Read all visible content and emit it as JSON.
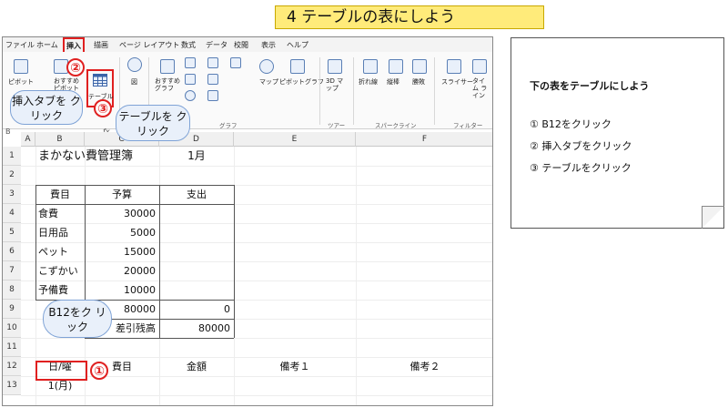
{
  "banner": "4 テーブルの表にしよう",
  "menu_tabs": [
    "ファイル",
    "ホーム",
    "挿入",
    "描画",
    "ページ レイアウト",
    "数式",
    "データ",
    "校閲",
    "表示",
    "ヘルプ"
  ],
  "ribbon": {
    "pivot_table": "ピボット",
    "recommended_pivot": "おすすめ ピボットテーブル",
    "table": "テーブル",
    "illustrations": "図",
    "recommended_charts": "おすすめ グラフ",
    "map": "マップ",
    "pivot_chart": "ピボットグラフ",
    "map3d": "3D マップ",
    "line": "折れ線",
    "column": "縦棒",
    "winloss": "勝敗",
    "slicer": "スライサー",
    "timeline": "タイム ライン",
    "group_chart": "グラフ",
    "group_tour": "ツアー",
    "group_sparkline": "スパークライン",
    "group_filter": "フィルター"
  },
  "formula_bar": {
    "namebox": "B",
    "fx": "fx"
  },
  "columns": [
    "A",
    "B",
    "C",
    "D",
    "E",
    "F"
  ],
  "rows": [
    "1",
    "2",
    "3",
    "4",
    "5",
    "6",
    "7",
    "8",
    "9",
    "10",
    "11",
    "12",
    "13"
  ],
  "sheet": {
    "title": "まかない費管理簿",
    "month": "1月",
    "headers": [
      "費目",
      "予算",
      "支出"
    ],
    "items": [
      {
        "name": "食費",
        "budget": "30000"
      },
      {
        "name": "日用品",
        "budget": "5000"
      },
      {
        "name": "ペット",
        "budget": "15000"
      },
      {
        "name": "こずかい",
        "budget": "20000"
      },
      {
        "name": "予備費",
        "budget": "10000"
      }
    ],
    "total_budget": "80000",
    "total_spend": "0",
    "balance_label": "差引残高",
    "balance": "80000",
    "row12": [
      "日/曜",
      "費目",
      "金額",
      "備考１",
      "備考２"
    ],
    "row13_date": "1(月)"
  },
  "callouts": {
    "tab": "挿入タブを クリック",
    "table": "テーブルを クリック",
    "cell": "B12をク リック"
  },
  "badges": [
    "①",
    "②",
    "③"
  ],
  "note": {
    "title": "下の表をテーブルにしよう",
    "steps": [
      "① B12をクリック",
      "② 挿入タブをクリック",
      "③ テーブルをクリック"
    ]
  }
}
